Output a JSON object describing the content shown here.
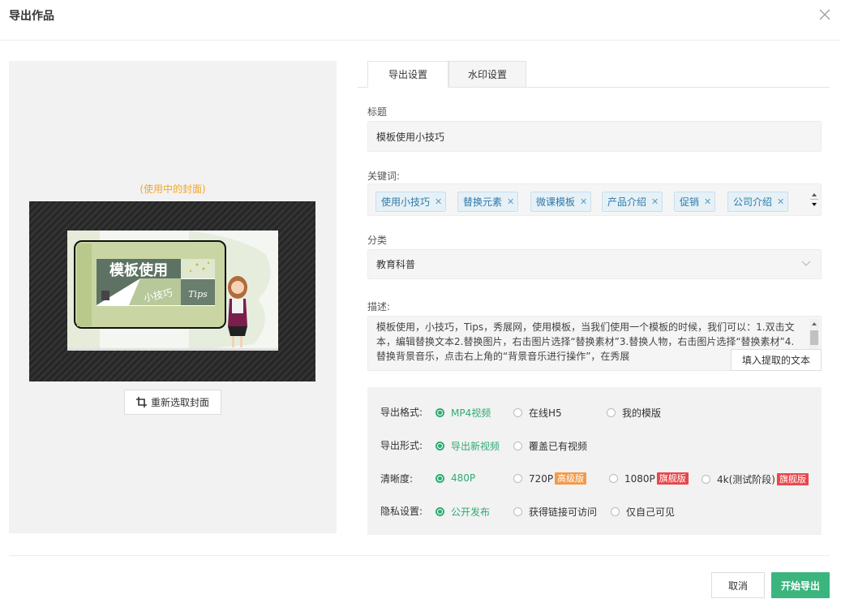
{
  "dialog": {
    "title": "导出作品"
  },
  "cover": {
    "in_use_label": "(使用中的封面)",
    "thumbnail_text_main": "模板使用",
    "thumbnail_text_sub": "小技巧",
    "thumbnail_text_tips": "Tips",
    "reselect_label": "重新选取封面"
  },
  "tabs": [
    {
      "label": "导出设置",
      "active": true
    },
    {
      "label": "水印设置",
      "active": false
    }
  ],
  "form": {
    "title_label": "标题",
    "title_value": "模板使用小技巧",
    "keywords_label": "关键词:",
    "keywords": [
      "使用小技巧",
      "替换元素",
      "微课模板",
      "产品介绍",
      "促销",
      "公司介绍"
    ],
    "category_label": "分类",
    "category_value": "教育科普",
    "description_label": "描述:",
    "description_value": "模板使用，小技巧，Tips，秀展网，使用模板，当我们使用一个模板的时候，我们可以：1.双击文本，编辑替换文本2.替换图片，右击图片选择“替换素材”3.替换人物，右击图片选择“替换素材”4.替换背景音乐，点击右上角的“背景音乐进行操作”，在秀展",
    "fill_extract_label": "填入提取的文本"
  },
  "options": {
    "format": {
      "label": "导出格式:",
      "choices": [
        "MP4视频",
        "在线H5",
        "我的模版"
      ],
      "selected": "MP4视频"
    },
    "mode": {
      "label": "导出形式:",
      "choices": [
        "导出新视频",
        "覆盖已有视频"
      ],
      "selected": "导出新视频"
    },
    "resolution": {
      "label": "清晰度:",
      "choices": [
        "480P",
        "720P",
        "1080P",
        "4k(测试阶段)"
      ],
      "badges": [
        "",
        "高级版",
        "旗舰版",
        "旗舰版"
      ],
      "selected": "480P"
    },
    "privacy": {
      "label": "隐私设置:",
      "choices": [
        "公开发布",
        "获得链接可访问",
        "仅自己可见"
      ],
      "selected": "公开发布"
    }
  },
  "footer": {
    "cancel_label": "取消",
    "start_label": "开始导出"
  },
  "colors": {
    "accent_green": "#3bb57d",
    "cover_label_orange": "#f5a623",
    "badge_advanced": "#f39a4a",
    "badge_flagship": "#e8474c",
    "keyword_tag_bg": "#e6f1f7"
  }
}
